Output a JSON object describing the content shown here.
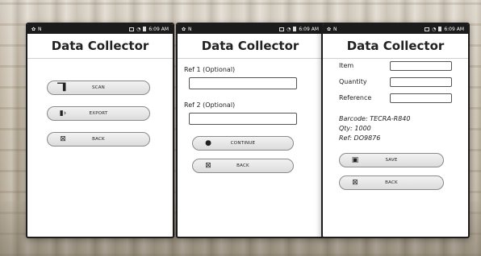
{
  "status": {
    "time": "6:09 AM"
  },
  "app_title": "Data Collector",
  "screen1": {
    "scan_label": "SCAN",
    "export_label": "EXPORT",
    "back_label": "BACK"
  },
  "screen2": {
    "ref1_label": "Ref 1 (Optional)",
    "ref2_label": "Ref 2 (Optional)",
    "continue_label": "CONTINUE",
    "back_label": "BACK"
  },
  "screen3": {
    "item_label": "Item",
    "quantity_label": "Quantity",
    "reference_label": "Reference",
    "barcode_line": "Barcode: TECRA-R840",
    "qty_line": "Qty: 1000",
    "ref_line": "Ref: DO9876",
    "save_label": "SAVE",
    "back_label": "BACK"
  },
  "icons": {
    "statusbar": [
      "settings-icon",
      "nfc-icon",
      "signal-icon",
      "wifi-icon",
      "battery-icon"
    ],
    "scan": "scan-icon",
    "export": "export-icon",
    "back": "close-box-icon",
    "continue": "check-circle-icon",
    "save": "save-icon"
  }
}
